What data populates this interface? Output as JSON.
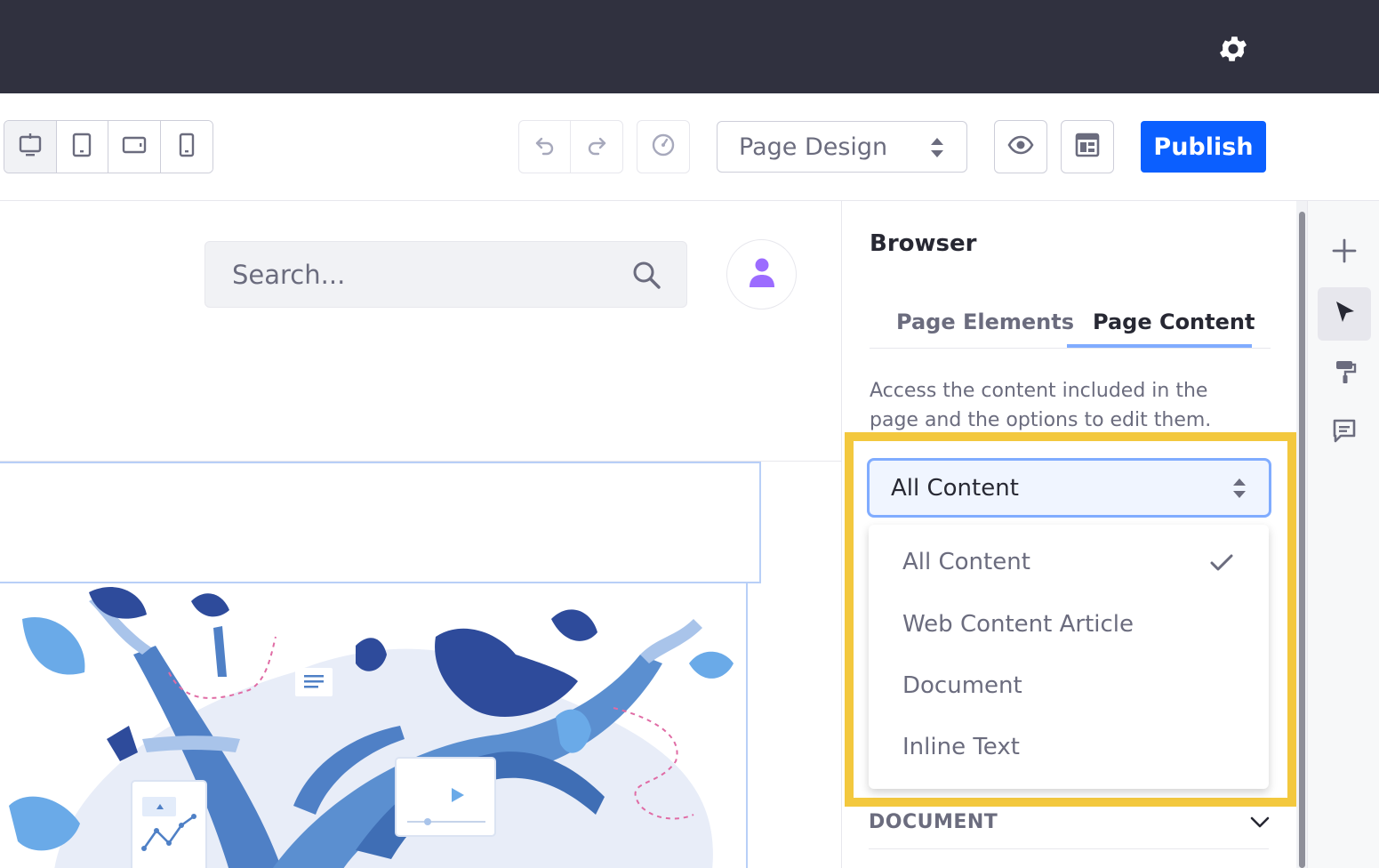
{
  "toolbar": {
    "page_mode": "Page Design",
    "publish_label": "Publish"
  },
  "canvas": {
    "search_placeholder": "Search..."
  },
  "panel": {
    "title": "Browser",
    "tabs": [
      {
        "label": "Page Elements",
        "active": false
      },
      {
        "label": "Page Content",
        "active": true
      }
    ],
    "description": "Access the content included in the page and the options to edit them.",
    "filter": {
      "selected": "All Content",
      "options": [
        "All Content",
        "Web Content Article",
        "Document",
        "Inline Text"
      ]
    },
    "section_heading": "DOCUMENT"
  },
  "colors": {
    "topbar": "#30313f",
    "primary": "#0b5fff",
    "highlight": "#f3c83e",
    "tab_underline": "#80acff"
  },
  "icons": [
    "gear-icon",
    "desktop-icon",
    "tablet-icon",
    "landscape-icon",
    "mobile-icon",
    "undo-icon",
    "redo-icon",
    "history-icon",
    "preview-icon",
    "page-layout-icon",
    "search-icon",
    "user-icon",
    "plus-icon",
    "cursor-icon",
    "paint-roller-icon",
    "comments-icon",
    "check-icon",
    "chevron-down-icon"
  ]
}
